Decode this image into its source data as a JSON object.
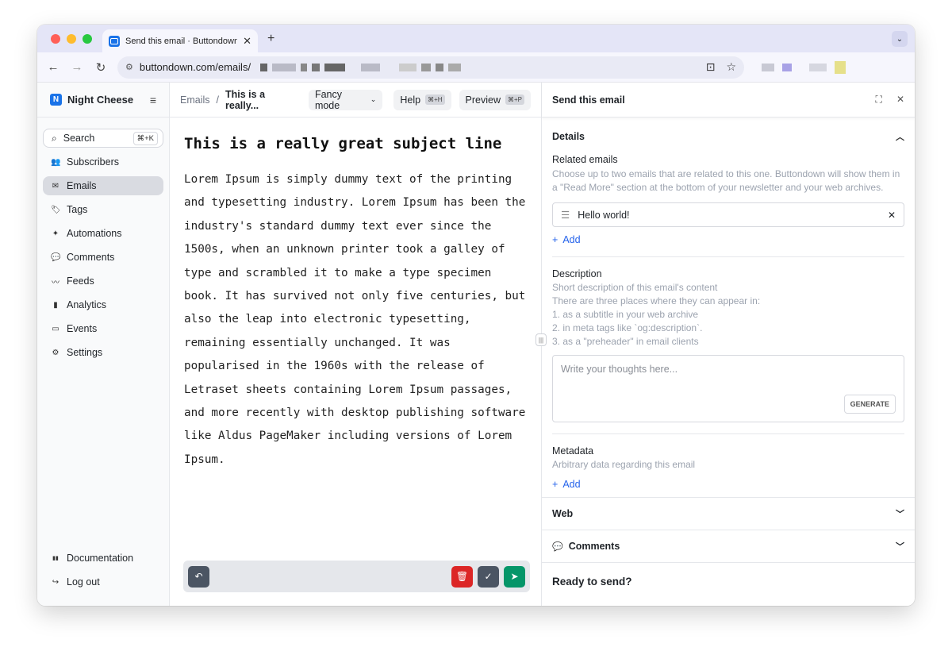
{
  "browser": {
    "tab_title": "Send this email · Buttondown",
    "tab_close": "✕",
    "new_tab": "+",
    "url": "buttondown.com/emails/",
    "colors": {
      "red": "#ff5f57",
      "yellow": "#febc2e",
      "green": "#28c840"
    }
  },
  "sidebar": {
    "brand_initial": "N",
    "brand_name": "Night Cheese",
    "search_label": "Search",
    "search_shortcut": "⌘+K",
    "items": [
      {
        "label": "Subscribers",
        "icon": "👥"
      },
      {
        "label": "Emails",
        "icon": "✉"
      },
      {
        "label": "Tags",
        "icon": "🏷"
      },
      {
        "label": "Automations",
        "icon": "✦"
      },
      {
        "label": "Comments",
        "icon": "💬"
      },
      {
        "label": "Feeds",
        "icon": "〰"
      },
      {
        "label": "Analytics",
        "icon": "▮"
      },
      {
        "label": "Events",
        "icon": "▭"
      },
      {
        "label": "Settings",
        "icon": "⚙"
      }
    ],
    "bottom": [
      {
        "label": "Documentation",
        "icon": "▮▮"
      },
      {
        "label": "Log out",
        "icon": "↪"
      }
    ]
  },
  "editor": {
    "breadcrumb_root": "Emails",
    "breadcrumb_sep": "/",
    "breadcrumb_current": "This is a really...",
    "mode_label": "Fancy mode",
    "help_label": "Help",
    "help_kbd": "⌘+H",
    "preview_label": "Preview",
    "preview_kbd": "⌘+P",
    "subject": "This is a really great subject line",
    "body": "Lorem Ipsum is simply dummy text of the printing and typesetting industry. Lorem Ipsum has been the industry's standard dummy text ever since the 1500s, when an unknown printer took a galley of type and scrambled it to make a type specimen book. It has survived not only five centuries, but also the leap into electronic typesetting, remaining essentially unchanged. It was popularised in the 1960s with the release of Letraset sheets containing Lorem Ipsum passages, and more recently with desktop publishing software like Aldus PageMaker including versions of Lorem Ipsum."
  },
  "panel": {
    "title": "Send this email",
    "details_label": "Details",
    "related_label": "Related emails",
    "related_help": "Choose up to two emails that are related to this one. Buttondown will show them in a \"Read More\" section at the bottom of your newsletter and your web archives.",
    "related_item": "Hello world!",
    "add_label": "Add",
    "description_label": "Description",
    "description_help_lines": [
      "Short description of this email's content",
      "There are three places where they can appear in:",
      "1. as a subtitle in your web archive",
      "2. in meta tags like `og:description`.",
      "3. as a \"preheader\" in email clients"
    ],
    "description_placeholder": "Write your thoughts here...",
    "generate_label": "GENERATE",
    "metadata_label": "Metadata",
    "metadata_help": "Arbitrary data regarding this email",
    "web_label": "Web",
    "comments_label": "Comments",
    "ready_label": "Ready to send?"
  },
  "colors": {
    "delete": "#dc2626",
    "check": "#4b5563",
    "send": "#059669",
    "undo": "#4b5563",
    "link": "#2563eb",
    "comments_icon": "#7c3aed"
  }
}
